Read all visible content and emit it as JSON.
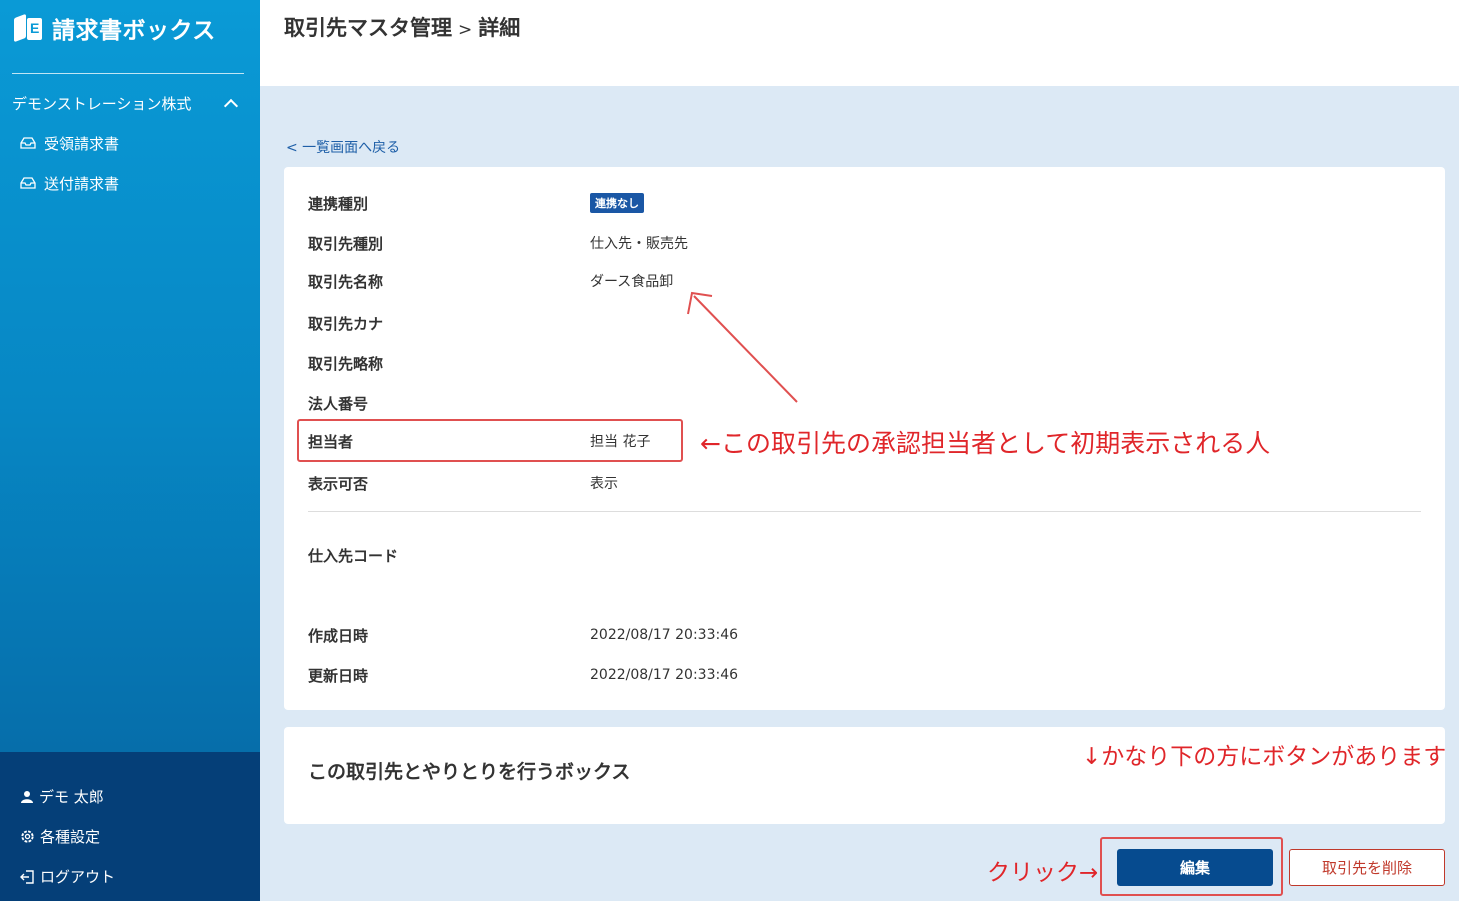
{
  "app": {
    "title": "請求書ボックス"
  },
  "sidebar": {
    "company": "デモンストレーション株式",
    "items": [
      {
        "label": "受領請求書",
        "icon": "inbox-icon"
      },
      {
        "label": "送付請求書",
        "icon": "outbox-icon"
      }
    ],
    "bottom": {
      "user": "デモ 太郎",
      "settings": "各種設定",
      "logout": "ログアウト"
    }
  },
  "header": {
    "title": "取引先マスタ管理",
    "separator": ">",
    "subtitle": "詳細"
  },
  "back_link": "< 一覧画面へ戻る",
  "details": {
    "rows": [
      {
        "label": "連携種別",
        "value": "連携なし",
        "type": "badge"
      },
      {
        "label": "取引先種別",
        "value": "仕入先・販売先"
      },
      {
        "label": "取引先名称",
        "value": "ダース食品卸"
      },
      {
        "label": "取引先カナ",
        "value": ""
      },
      {
        "label": "取引先略称",
        "value": ""
      },
      {
        "label": "法人番号",
        "value": ""
      },
      {
        "label": "担当者",
        "value": "担当 花子"
      },
      {
        "label": "表示可否",
        "value": "表示"
      }
    ],
    "supplier_code_label": "仕入先コード",
    "created_label": "作成日時",
    "created_value": "2022/08/17 20:33:46",
    "updated_label": "更新日時",
    "updated_value": "2022/08/17 20:33:46"
  },
  "boxes_section": {
    "title": "この取引先とやりとりを行うボックス"
  },
  "actions": {
    "edit": "編集",
    "delete": "取引先を削除"
  },
  "annotations": {
    "approver_note": "←この取引先の承認担当者として初期表示される人",
    "button_note": "↓かなり下の方にボタンがあります",
    "click_note": "クリック→"
  },
  "colors": {
    "accent": "#064b8f",
    "annotation": "#e0262a",
    "danger": "#c0392b"
  }
}
